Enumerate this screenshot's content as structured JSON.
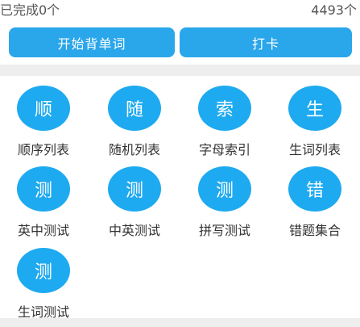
{
  "status": {
    "completed": "已完成0个",
    "total": "4493个"
  },
  "actions": {
    "start_label": "开始背单词",
    "checkin_label": "打卡"
  },
  "menu": [
    {
      "icon_char": "顺",
      "label": "顺序列表"
    },
    {
      "icon_char": "随",
      "label": "随机列表"
    },
    {
      "icon_char": "索",
      "label": "字母索引"
    },
    {
      "icon_char": "生",
      "label": "生词列表"
    },
    {
      "icon_char": "测",
      "label": "英中测试"
    },
    {
      "icon_char": "测",
      "label": "中英测试"
    },
    {
      "icon_char": "测",
      "label": "拼写测试"
    },
    {
      "icon_char": "错",
      "label": "错题集合"
    },
    {
      "icon_char": "测",
      "label": "生词测试"
    }
  ],
  "colors": {
    "accent": "#2aa6ea",
    "circle": "#1eaaf0",
    "background_gap": "#eeeeee"
  }
}
